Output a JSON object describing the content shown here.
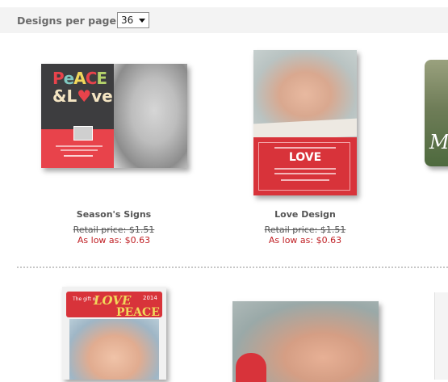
{
  "toolbar": {
    "per_page_label": "Designs per page:",
    "per_page_value": "36"
  },
  "products": [
    {
      "title": "Season's Signs",
      "retail": "Retail price: $1.51",
      "low": "As low as: $0.63",
      "card_text": {
        "peace": [
          "P",
          "e",
          "A",
          "C",
          "E"
        ],
        "love_prefix": "&L",
        "love_heart": "♥",
        "love_suffix": "ve"
      }
    },
    {
      "title": "Love Design",
      "retail": "Retail price: $1.51",
      "low": "As low as: $0.63",
      "card_text": {
        "love": "LOVE"
      }
    },
    {
      "card_text": {
        "script": "M"
      }
    },
    {
      "card_text": {
        "small": "The gift of",
        "love": "LOVE",
        "year": "2014",
        "peace": "PEACE"
      }
    }
  ],
  "colors": {
    "accent_red": "#d8333a",
    "price_red": "#c01f24",
    "bar_bg": "#f3f3f3"
  }
}
